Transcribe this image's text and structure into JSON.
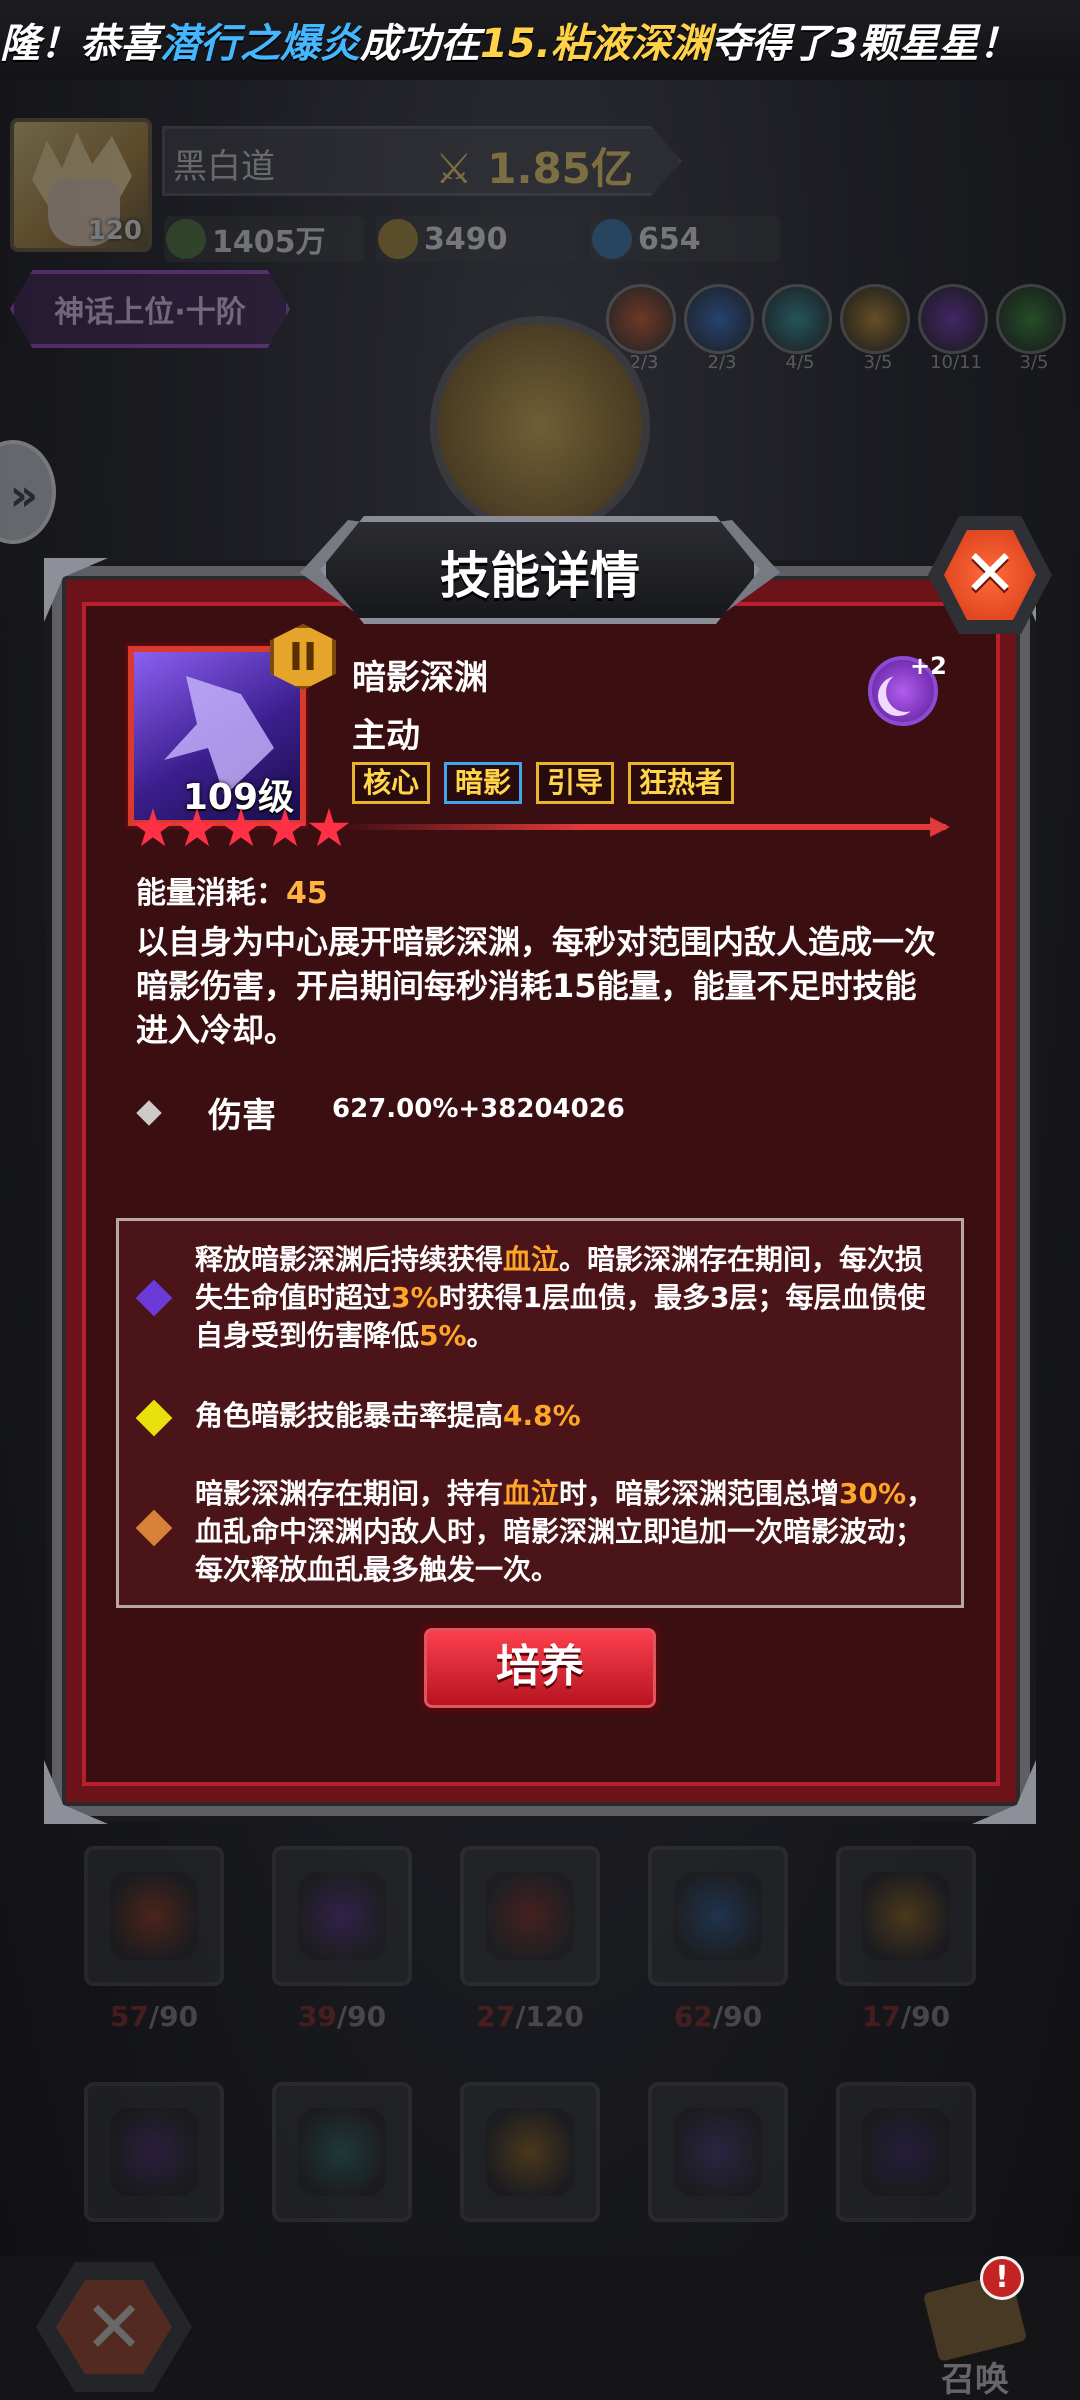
{
  "banner": {
    "prefix": "隆！恭喜",
    "player": "潜行之爆炎",
    "middle": "成功在",
    "stage": "15.粘液深渊",
    "suffix": "夺得了3颗星星！"
  },
  "profile": {
    "name": "黑白道",
    "power": "1.85亿",
    "level": "120",
    "resources": [
      "1405万",
      "3490",
      "654"
    ],
    "rank": "神话上位·十阶"
  },
  "elements": [
    {
      "icon": "fire-element-icon",
      "count": "2/3",
      "color": "#d0541e"
    },
    {
      "icon": "ice-element-icon",
      "count": "2/3",
      "color": "#2a6fd0"
    },
    {
      "icon": "frost-element-icon",
      "count": "4/5",
      "color": "#2c9fa8"
    },
    {
      "icon": "light-element-icon",
      "count": "3/5",
      "color": "#c9972a"
    },
    {
      "icon": "shadow-element-icon",
      "count": "10/11",
      "color": "#7c39c9"
    },
    {
      "icon": "nature-element-icon",
      "count": "3/5",
      "color": "#3a9a3a"
    }
  ],
  "modal": {
    "title": "技能详情",
    "tier": "II",
    "level_label": "109级",
    "stars": 5,
    "skill_name": "暗影深渊",
    "skill_type": "主动",
    "tags": [
      "核心",
      "暗影",
      "引导",
      "狂热者"
    ],
    "moon_bonus": "+2",
    "energy_label": "能量消耗：",
    "energy_value": "45",
    "description": "以自身为中心展开暗影深渊，每秒对范围内敌人造成一次暗影伤害，开启期间每秒消耗15能量，能量不足时技能进入冷却。",
    "damage_label": "伤害",
    "damage_value": "627.00%+38204026",
    "passives": [
      {
        "color": "purple",
        "parts": [
          "释放暗影深渊后持续获得",
          "血泣",
          "。暗影深渊存在期间，每次损失生命值时超过",
          "3%",
          "时获得1层血债，最多3层；每层血债使自身受到伤害降低",
          "5%",
          "。"
        ]
      },
      {
        "color": "yellow",
        "parts": [
          "角色暗影技能暴击率提高",
          "4.8%"
        ]
      },
      {
        "color": "orange",
        "parts": [
          "暗影深渊存在期间，持有",
          "血泣",
          "时，暗影深渊范围总增",
          "30%",
          "，血乱命中深渊内敌人时，暗影深渊立即追加一次暗影波动；每次释放血乱最多触发一次。"
        ]
      }
    ],
    "train_button": "培养"
  },
  "skill_slots": [
    {
      "icon": "fire-claw-skill-icon",
      "have": "57",
      "need": "/90",
      "color": "#a33b1c"
    },
    {
      "icon": "shadow-wisp-skill-icon",
      "have": "39",
      "need": "/90",
      "color": "#5b2f8e"
    },
    {
      "icon": "blood-runner-skill-icon",
      "have": "27",
      "need": "/120",
      "color": "#8a2a1f"
    },
    {
      "icon": "ice-crown-skill-icon",
      "have": "62",
      "need": "/90",
      "color": "#2a5e9a"
    },
    {
      "icon": "gold-sigil-skill-icon",
      "have": "17",
      "need": "/90",
      "color": "#a3701e"
    },
    {
      "icon": "shadow-mage-skill-icon",
      "color": "#4d2f77"
    },
    {
      "icon": "eye-rune-skill-icon",
      "color": "#2b6e6a"
    },
    {
      "icon": "flame-fist-skill-icon",
      "color": "#9a6a1c"
    },
    {
      "icon": "void-star-skill-icon",
      "color": "#4b3a7e"
    },
    {
      "icon": "shadow-vortex-skill-icon",
      "color": "#3e2a6e"
    }
  ],
  "bottom": {
    "summon_label": "召唤",
    "badge": "!"
  }
}
